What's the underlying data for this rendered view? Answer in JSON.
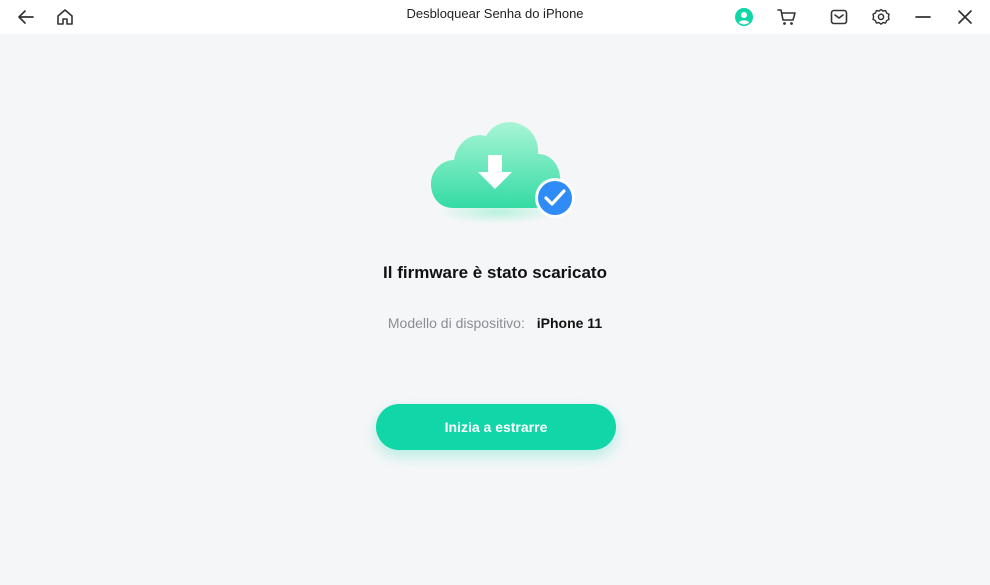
{
  "window": {
    "title": "Desbloquear Senha do iPhone"
  },
  "titlebar": {
    "icons": {
      "back": "arrow-left-icon",
      "home": "home-icon",
      "account": "user-circle-icon",
      "cart": "cart-icon",
      "mail": "mail-icon",
      "settings": "gear-icon",
      "minimize": "minimize-icon",
      "close": "close-icon"
    },
    "accent_color": "#10d6a8"
  },
  "main": {
    "hero_icon": "cloud-download-check-icon",
    "heading": "Il firmware è stato scaricato",
    "device_label": "Modello di dispositivo:",
    "device_value": "iPhone 11",
    "action_button_label": "Inizia a estrarre",
    "button_color": "#10d6a8",
    "check_badge_color": "#2f8cf6"
  }
}
